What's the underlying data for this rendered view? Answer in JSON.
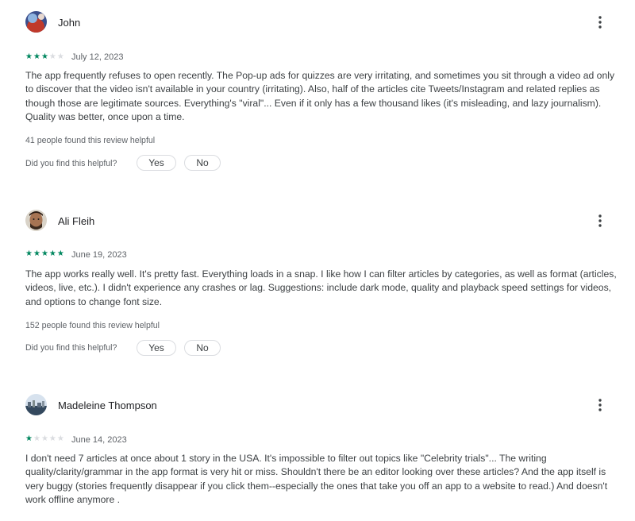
{
  "reviews": [
    {
      "author": "John",
      "avatar_icon": "avatar-john",
      "rating": 3,
      "date": "July 12, 2023",
      "text": "The app frequently refuses to open recently. The Pop-up ads for quizzes are very irritating, and sometimes you sit through a video ad only to discover that the video isn't available in your country (irritating). Also, half of the articles cite Tweets/Instagram and related replies as though those are legitimate sources. Everything's \"viral\"... Even if it only has a few thousand likes (it's misleading, and lazy journalism). Quality was better, once upon a time.",
      "helpful_count": "41 people found this review helpful",
      "helpful_question": "Did you find this helpful?",
      "yes_label": "Yes",
      "no_label": "No"
    },
    {
      "author": "Ali Fleih",
      "avatar_icon": "avatar-ali",
      "rating": 5,
      "date": "June 19, 2023",
      "text": "The app works really well. It's pretty fast. Everything loads in a snap. I like how I can filter articles by categories, as well as format (articles, videos, live, etc.). I didn't experience any crashes or lag. Suggestions: include dark mode, quality and playback speed settings for videos, and options to change font size.",
      "helpful_count": "152 people found this review helpful",
      "helpful_question": "Did you find this helpful?",
      "yes_label": "Yes",
      "no_label": "No"
    },
    {
      "author": "Madeleine Thompson",
      "avatar_icon": "avatar-madeleine",
      "rating": 1,
      "date": "June 14, 2023",
      "text": "I don't need 7 articles at once about 1 story in the USA. It's impossible to filter out topics like \"Celebrity trials\"... The writing quality/clarity/grammar in the app format is very hit or miss. Shouldn't there be an editor looking over these articles? And the app itself is very buggy (stories frequently disappear if you click them--especially the ones that take you off an app to a website to read.) And doesn't work offline anymore ."
    }
  ],
  "icons": {
    "more": "more-vert-icon",
    "star": "star-icon"
  },
  "colors": {
    "star_on": "#01875f",
    "star_off": "#dadce0",
    "text": "#3c4043",
    "muted": "#5f6368"
  }
}
